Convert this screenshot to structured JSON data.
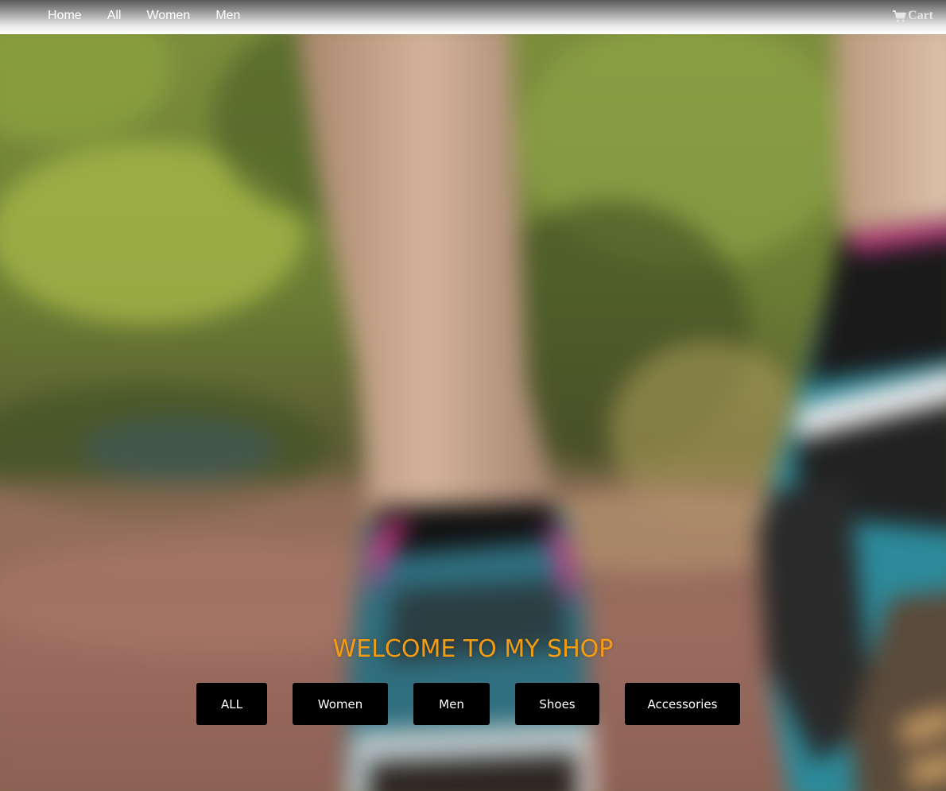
{
  "nav": {
    "links": [
      "Home",
      "All",
      "Women",
      "Men"
    ],
    "cart_label": "Cart",
    "cart_icon": "shopping-cart-icon"
  },
  "hero": {
    "welcome": "WELCOME TO MY SHOP",
    "welcome_color": "#f39c12",
    "categories": [
      "ALL",
      "Women",
      "Men",
      "Shoes",
      "Accessories"
    ],
    "button_bg": "#000000",
    "button_text_color": "#ffffff"
  }
}
